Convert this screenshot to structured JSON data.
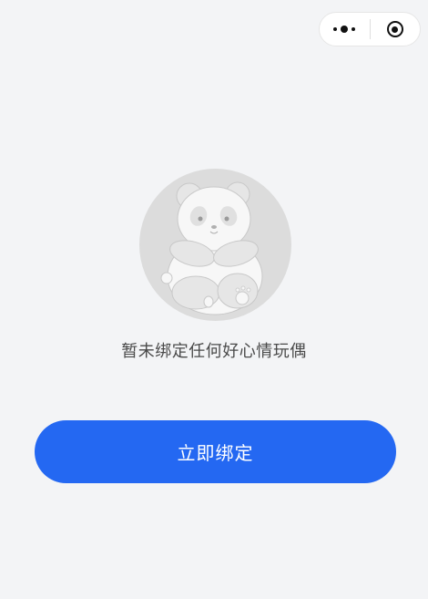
{
  "capsule": {
    "menu_icon": "more-dots-icon",
    "close_icon": "target-circle-icon"
  },
  "illustration": {
    "icon": "panda-icon"
  },
  "empty_state": {
    "message": "暂未绑定任何好心情玩偶"
  },
  "actions": {
    "bind_label": "立即绑定"
  },
  "colors": {
    "background": "#f3f4f6",
    "primary": "#2468f2",
    "avatar_bg": "#dcdcdc"
  }
}
